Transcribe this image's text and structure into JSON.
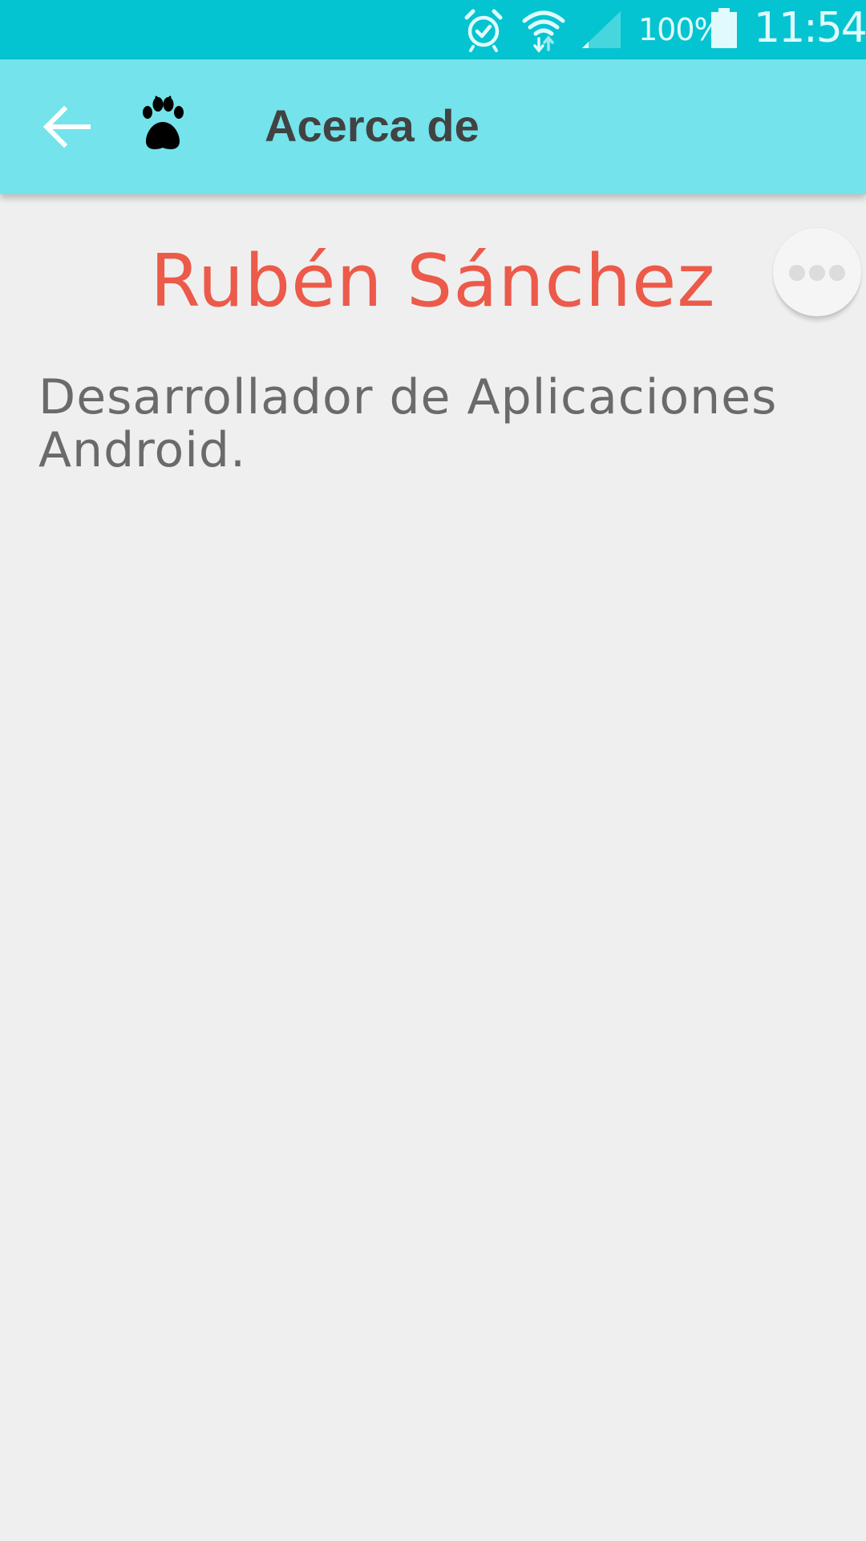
{
  "status_bar": {
    "battery_percent": "100%",
    "time": "11:54",
    "icons": [
      "alarm-icon",
      "wifi-icon",
      "signal-icon",
      "battery-icon"
    ]
  },
  "app_bar": {
    "title": "Acerca de",
    "back_icon": "arrow-back-icon",
    "logo_icon": "paw-icon",
    "background": "#74e3eb"
  },
  "content": {
    "name": "Rubén Sánchez",
    "description": "Desarrollador de Aplicaciones Android."
  },
  "colors": {
    "status_bar": "#05c4d1",
    "name": "#ec5a4a",
    "description": "#6a6a6a",
    "background": "#efeff0"
  }
}
